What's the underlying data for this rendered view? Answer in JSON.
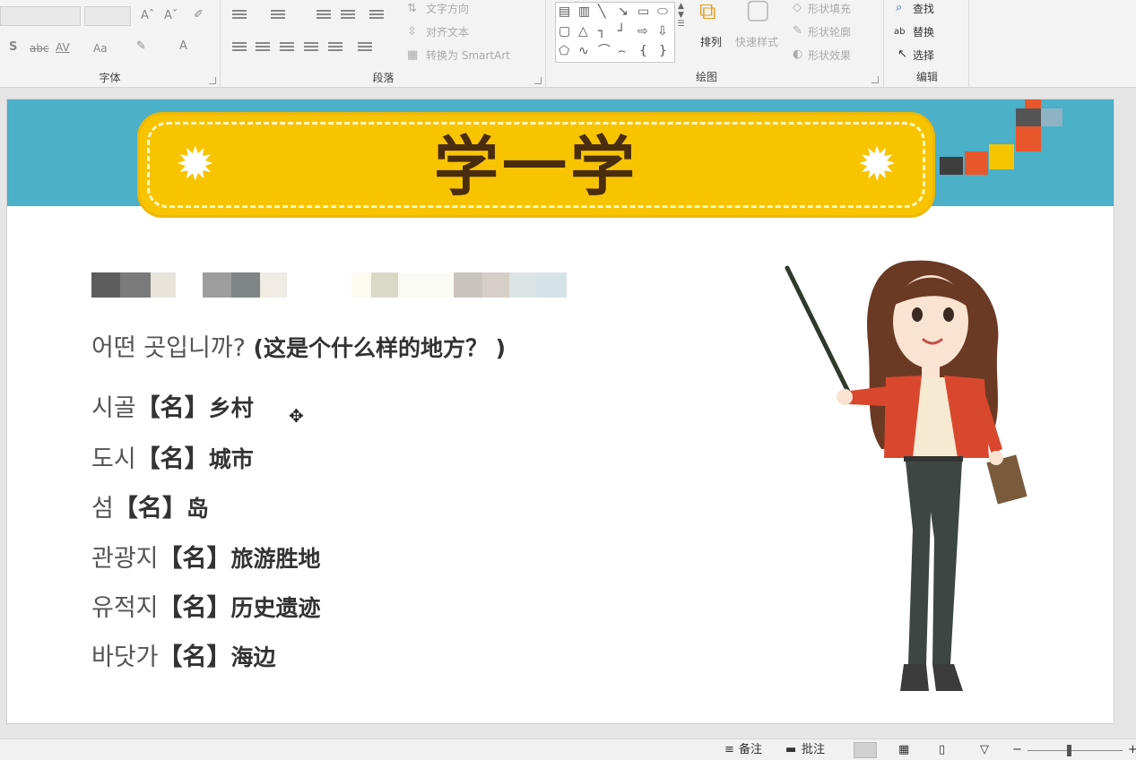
{
  "ribbon": {
    "font_group": {
      "label": "字体",
      "strike_label": "abc",
      "spacing_label": "AV",
      "case_label": "Aa",
      "grow_label": "Aˆ",
      "shrink_label": "Aˇ",
      "shadow_label": "S",
      "color_label": "A"
    },
    "paragraph_group": {
      "label": "段落",
      "text_direction": "文字方向",
      "align_text": "对齐文本",
      "convert_smartart": "转换为 SmartArt"
    },
    "drawing_group": {
      "label": "绘图",
      "arrange": "排列",
      "quick_styles": "快速样式",
      "shape_fill": "形状填充",
      "shape_outline": "形状轮廓",
      "shape_effects": "形状效果"
    },
    "editing_group": {
      "label": "编辑",
      "find": "查找",
      "replace": "替换",
      "select": "选择"
    }
  },
  "slide": {
    "title": "学一学",
    "question_ko": "어떤 곳입니까?",
    "question_cn": "(这是个什么样的地方？ )",
    "vocab": [
      {
        "ko": "시골",
        "tag": "【名】",
        "cn": "乡村"
      },
      {
        "ko": "도시",
        "tag": "【名】",
        "cn": "城市"
      },
      {
        "ko": "섬",
        "tag": "【名】",
        "cn": "岛"
      },
      {
        "ko": "관광지",
        "tag": "【名】",
        "cn": "旅游胜地"
      },
      {
        "ko": "유적지",
        "tag": "【名】",
        "cn": "历史遗迹"
      },
      {
        "ko": "바닷가",
        "tag": "【名】",
        "cn": "海边"
      }
    ],
    "colors": {
      "banner": "#4bb0c8",
      "title_bg": "#f8c400",
      "title_text": "#4a2c0f"
    }
  },
  "statusbar": {
    "notes": "备注",
    "comments": "批注"
  }
}
